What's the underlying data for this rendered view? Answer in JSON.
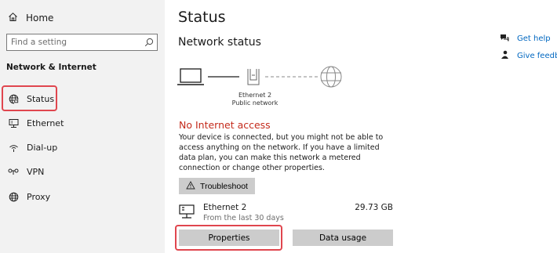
{
  "sidebar": {
    "home_label": "Home",
    "search_placeholder": "Find a setting",
    "section_title": "Network & Internet",
    "items": [
      {
        "label": "Status",
        "icon": "globe-status-icon"
      },
      {
        "label": "Ethernet",
        "icon": "ethernet-icon"
      },
      {
        "label": "Dial-up",
        "icon": "dialup-icon"
      },
      {
        "label": "VPN",
        "icon": "vpn-icon"
      },
      {
        "label": "Proxy",
        "icon": "globe-icon"
      }
    ]
  },
  "main": {
    "title": "Status",
    "network_status_heading": "Network status",
    "diagram": {
      "adapter_name": "Ethernet 2",
      "network_type": "Public network"
    },
    "alert_title": "No Internet access",
    "alert_description": "Your device is connected, but you might not be able to access anything on the network. If you have a limited data plan, you can make this network a metered connection or change other properties.",
    "troubleshoot_label": "Troubleshoot",
    "connection": {
      "name": "Ethernet 2",
      "period": "From the last 30 days",
      "usage": "29.73 GB"
    },
    "properties_label": "Properties",
    "data_usage_label": "Data usage"
  },
  "related": {
    "get_help": "Get help",
    "give_feedback": "Give feedbac"
  },
  "colors": {
    "accent_link": "#0067c0",
    "alert_red": "#c42b1c",
    "highlight_red": "#e0464e",
    "sidebar_bg": "#f2f2f2",
    "button_bg": "#cccccc"
  }
}
